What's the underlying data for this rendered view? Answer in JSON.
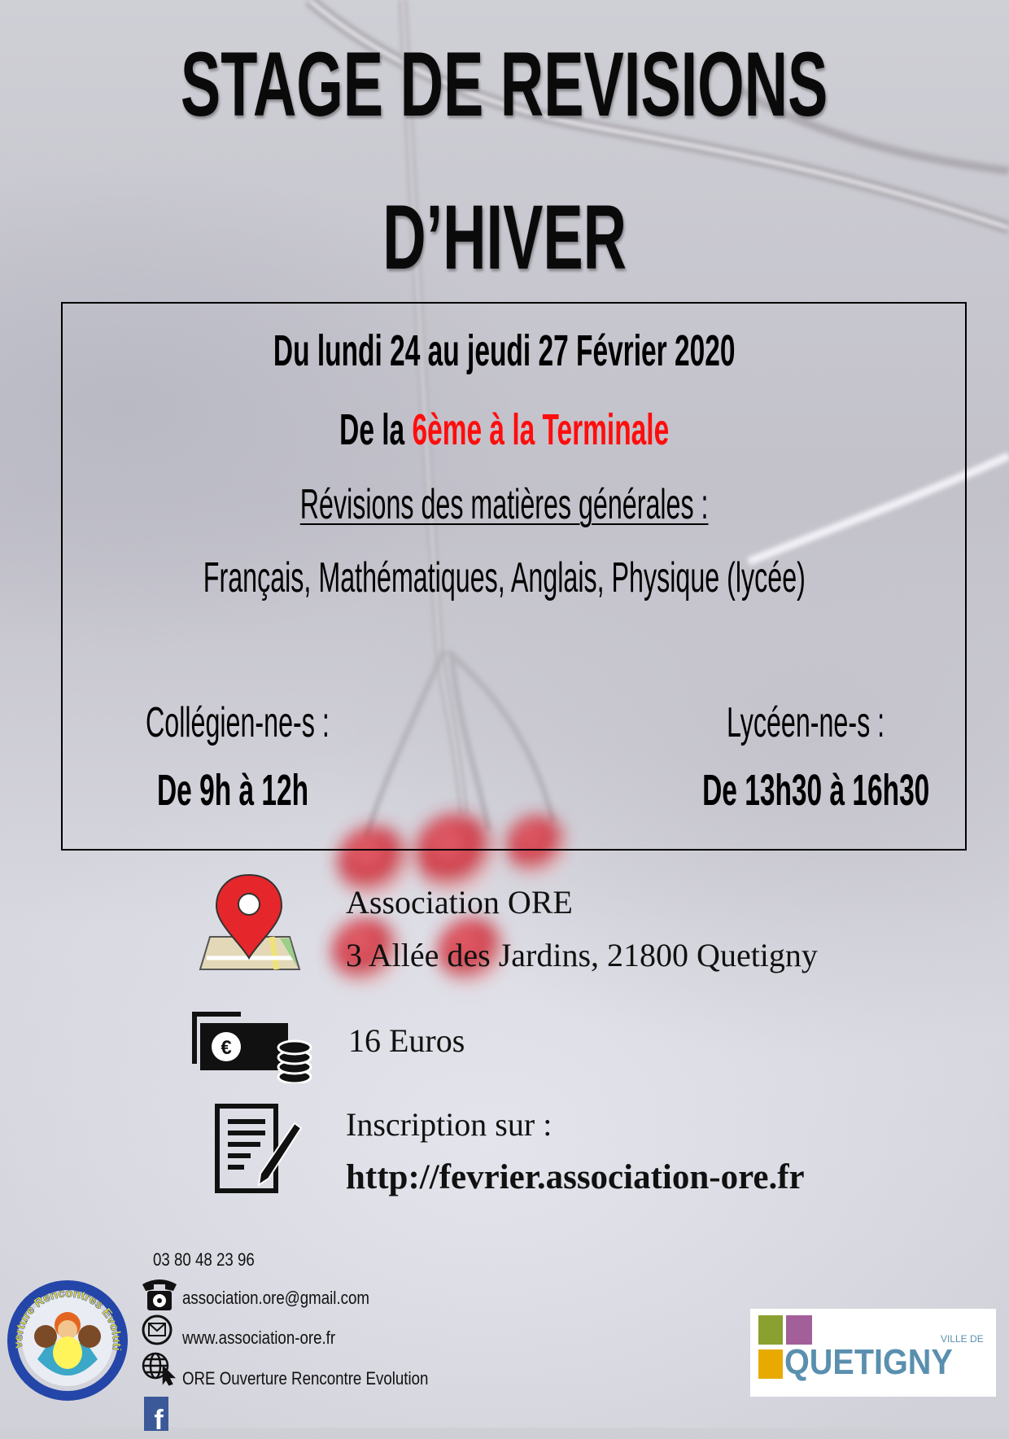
{
  "title": {
    "line1": "STAGE DE REVISIONS",
    "line2": "D’HIVER"
  },
  "info_box": {
    "dates": "Du lundi 24 au jeudi 27 Février 2020",
    "levels_prefix": "De la ",
    "levels_highlight": "6ème à la Terminale",
    "subjects_heading": "Révisions des matières générales :",
    "subjects": "Français, Mathématiques, Anglais, Physique (lycée)",
    "college_label": "Collégien-ne-s :",
    "college_hours": "De 9h à 12h",
    "lycee_label": "Lycéen-ne-s :",
    "lycee_hours": "De 13h30 à 16h30"
  },
  "details": {
    "location_name": "Association ORE",
    "location_address": "3 Allée des Jardins, 21800 Quetigny",
    "price": "16 Euros",
    "registration_label": "Inscription sur :",
    "registration_url": "http://fevrier.association-ore.fr",
    "icons": [
      "map-pin-icon",
      "money-icon",
      "form-icon"
    ]
  },
  "contact": {
    "phone": "03 80 48 23 96",
    "email": "association.ore@gmail.com",
    "website": "www.association-ore.fr",
    "facebook": "ORE Ouverture Rencontre Evolution"
  },
  "logos": {
    "ore": "Ouverture Rencontres Evolution",
    "quetigny_small": "VILLE DE",
    "quetigny": "QUETIGNY"
  },
  "colors": {
    "highlight": "#ff0d0d",
    "facebook": "#3b5998"
  }
}
